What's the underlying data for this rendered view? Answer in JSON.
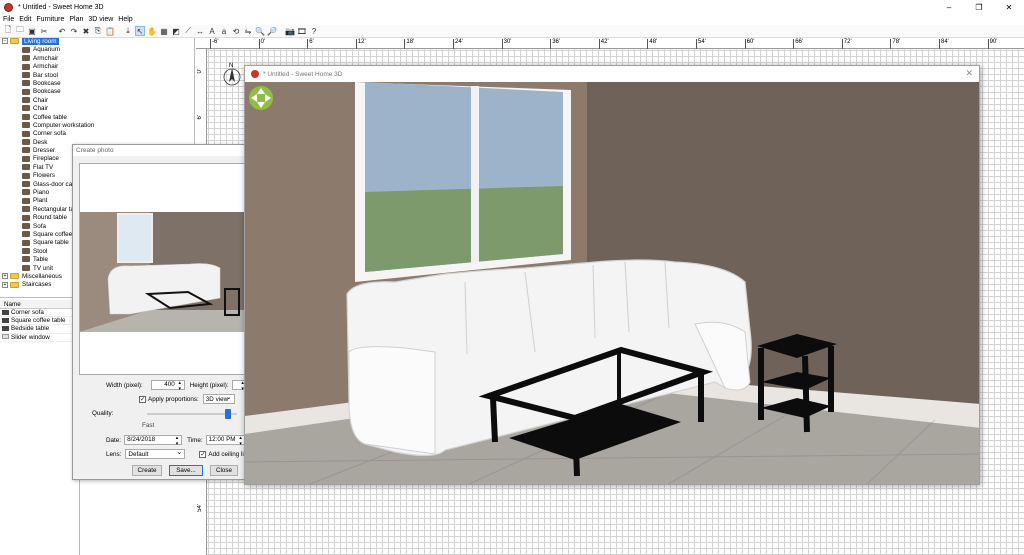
{
  "window": {
    "title": "* Untitled - Sweet Home 3D",
    "min": "–",
    "max": "❐",
    "close": "✕"
  },
  "menu": [
    "File",
    "Edit",
    "Furniture",
    "Plan",
    "3D view",
    "Help"
  ],
  "catalog": {
    "category": "Living room",
    "items": [
      "Aquarium",
      "Armchair",
      "Armchair",
      "Bar stool",
      "Bookcase",
      "Bookcase",
      "Chair",
      "Chair",
      "Coffee table",
      "Computer workstation",
      "Corner sofa",
      "Desk",
      "Dresser",
      "Fireplace",
      "Flat TV",
      "Flowers",
      "Glass-door cab",
      "Piano",
      "Plant",
      "Rectangular ta",
      "Round table",
      "Sofa",
      "Square coffee",
      "Square table",
      "Stool",
      "Table",
      "TV unit"
    ],
    "other_categories": [
      "Miscellaneous",
      "Staircases"
    ]
  },
  "furniture_list": {
    "header": "Name",
    "rows": [
      "Corner sofa",
      "Square coffee table",
      "Bedside table",
      "Slider window"
    ]
  },
  "ruler": {
    "top": [
      "-6'",
      "0'",
      "6'",
      "12'",
      "18'",
      "24'",
      "30'",
      "36'",
      "42'",
      "48'",
      "54'",
      "60'",
      "66'",
      "72'",
      "78'",
      "84'",
      "90'"
    ],
    "left": [
      "0'",
      "6'",
      "54'"
    ]
  },
  "compass": {
    "label": "N"
  },
  "photo_dialog": {
    "title": "Create photo",
    "width_label": "Width (pixel):",
    "width_value": "400",
    "height_label": "Height (pixel):",
    "apply_proportions": "Apply proportions:",
    "proportions_value": "3D view",
    "quality_label": "Quality:",
    "quality_min": "Fast",
    "quality_level": 0.9,
    "date_label": "Date:",
    "date_value": "8/24/2018",
    "time_label": "Time:",
    "time_value": "12:00 PM",
    "lens_label": "Lens:",
    "lens_value": "Default",
    "ceiling_label": "Add ceiling ligh",
    "create": "Create",
    "save": "Save...",
    "close": "Close"
  },
  "view3d": {
    "title": "* Untitled - Sweet Home 3D",
    "close": "✕"
  },
  "colors": {
    "wall_left": "#8c7b6d",
    "wall_right": "#6e6259",
    "floor": "#a9a6a0",
    "sofa": "#f4f4f4",
    "table": "#0c0c0c",
    "selection": "#2a6fd6",
    "folder": "#f0c94d"
  }
}
